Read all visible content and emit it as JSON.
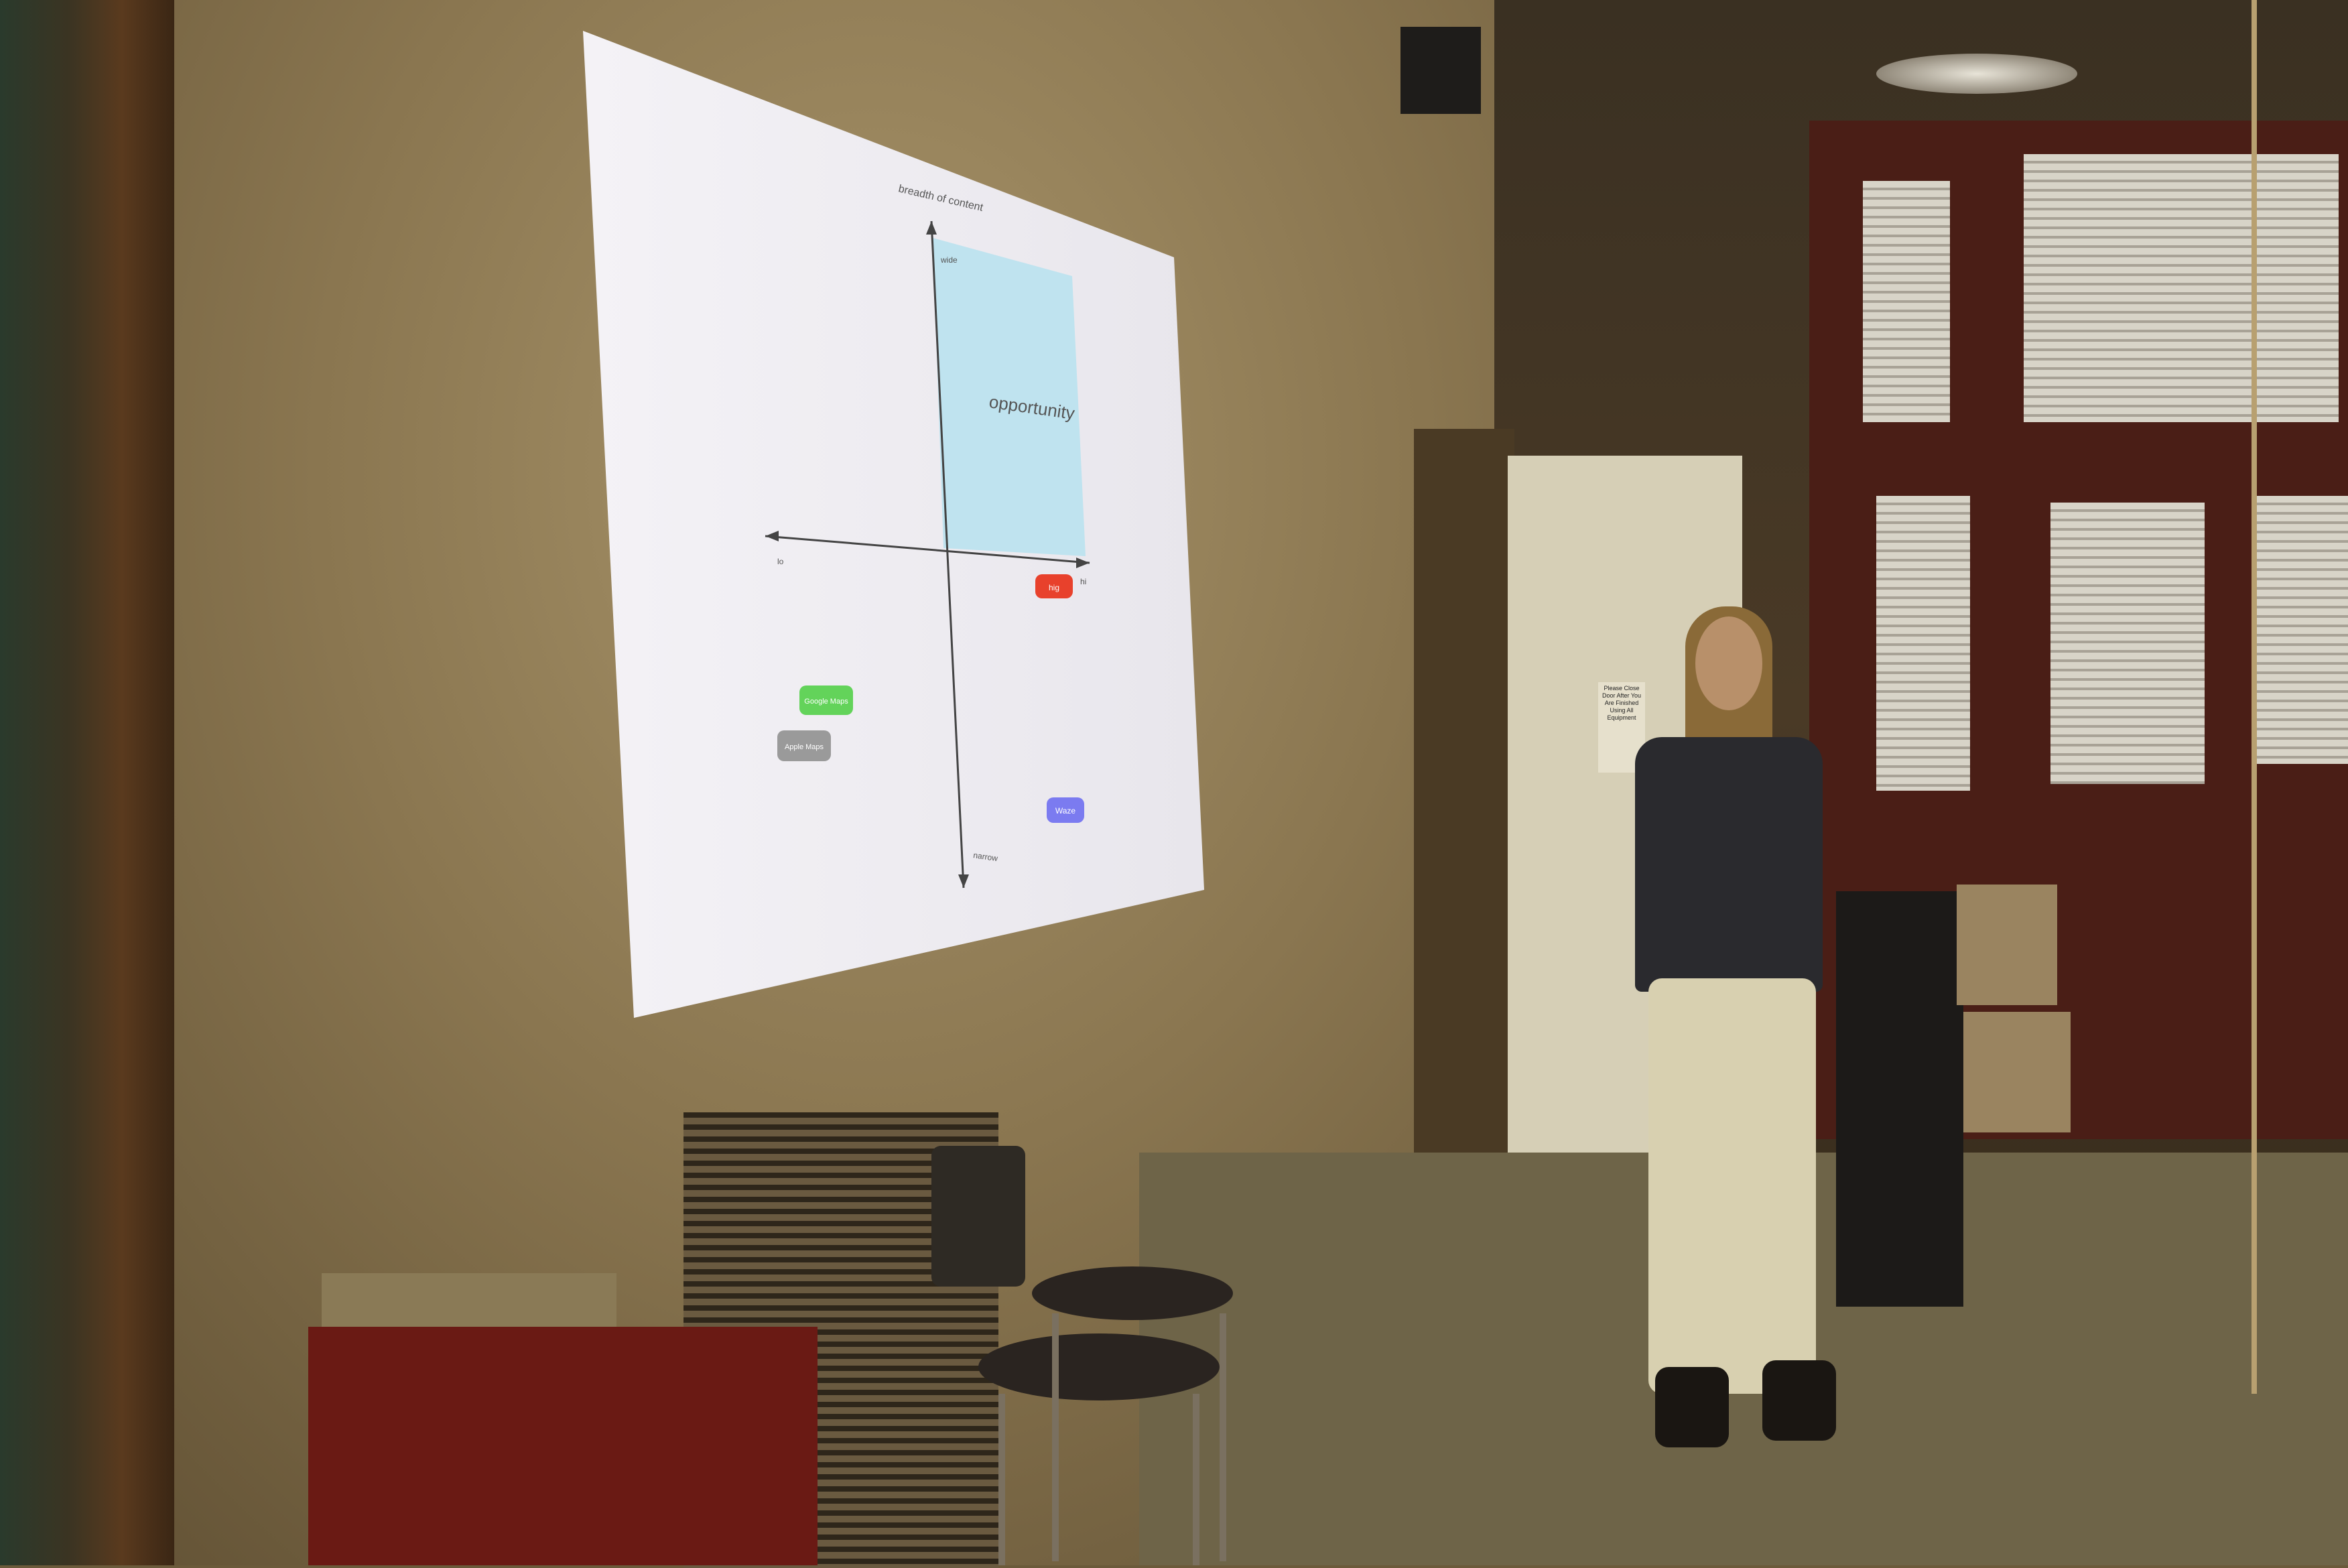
{
  "slide": {
    "title": "breadth of content",
    "top_label": "wide",
    "bottom_label": "narrow",
    "left_label": "lo",
    "right_label": "hi",
    "right_axis_label": "",
    "quadrant_label": "opportunity",
    "quadrant_color": "#bfe3ef",
    "chips": [
      {
        "label": "hig",
        "color": "#e8412c"
      },
      {
        "label": "Google Maps",
        "color": "#63d35a"
      },
      {
        "label": "Apple Maps",
        "color": "#9a9a9a"
      },
      {
        "label": "Waze",
        "color": "#7b7bf0"
      }
    ]
  },
  "sign": {
    "text": "Please Close Door After You Are Finished Using All Equipment"
  }
}
